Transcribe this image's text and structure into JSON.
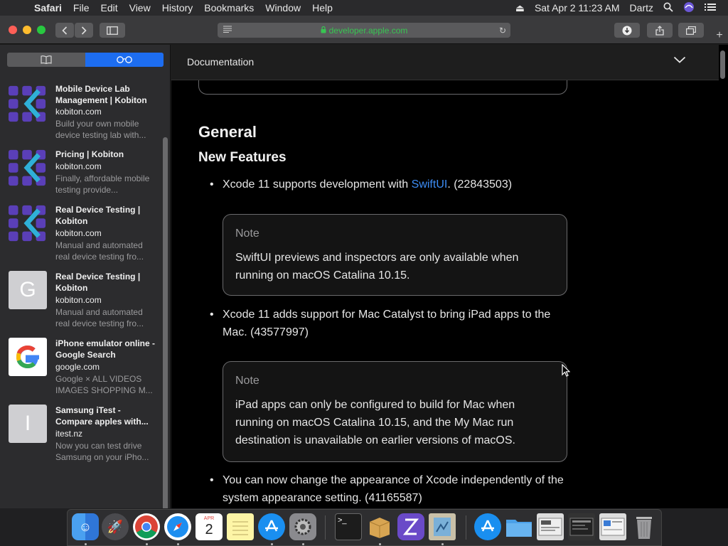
{
  "menubar": {
    "app": "Safari",
    "items": [
      "File",
      "Edit",
      "View",
      "History",
      "Bookmarks",
      "Window",
      "Help"
    ],
    "datetime": "Sat Apr 2  11:23 AM",
    "user": "Dartz"
  },
  "toolbar": {
    "url": "developer.apple.com"
  },
  "sidebar": {
    "items": [
      {
        "title": "Mobile Device Lab Management | Kobiton",
        "domain": "kobiton.com",
        "desc": "Build your own mobile device testing lab with...",
        "thumb": "kobiton-logo"
      },
      {
        "title": "Pricing | Kobiton",
        "domain": "kobiton.com",
        "desc": "Finally, affordable mobile testing provide...",
        "thumb": "kobiton-logo"
      },
      {
        "title": "Real Device Testing | Kobiton",
        "domain": "kobiton.com",
        "desc": "Manual and automated real device testing fro...",
        "thumb": "kobiton-logo"
      },
      {
        "title": "Real Device Testing | Kobiton",
        "domain": "kobiton.com",
        "desc": "Manual and automated real device testing fro...",
        "thumb": "G"
      },
      {
        "title": "iPhone emulator online - Google Search",
        "domain": "google.com",
        "desc": "Google × ALL VIDEOS IMAGES SHOPPING M...",
        "thumb": "google-logo"
      },
      {
        "title": "Samsung iTest - Compare apples with...",
        "domain": "itest.nz",
        "desc": "Now you can test drive Samsung on your iPho...",
        "thumb": "I"
      }
    ]
  },
  "doc": {
    "header": "Documentation",
    "section": "General",
    "subsection": "New Features",
    "bullet1_pre": "Xcode 11 supports development with ",
    "bullet1_link": "SwiftUI",
    "bullet1_post": ". (22843503)",
    "note1_label": "Note",
    "note1_body": "SwiftUI previews and inspectors are only available when running on macOS Catalina 10.15.",
    "bullet2": "Xcode 11 adds support for Mac Catalyst to bring iPad apps to the Mac. (43577997)",
    "note2_label": "Note",
    "note2_body": "iPad apps can only be configured to build for Mac when running on macOS Catalina 10.15, and the My Mac run destination is unavailable on earlier versions of macOS.",
    "bullet3": "You can now change the appearance of Xcode independently of the system appearance setting. (41165587)"
  },
  "dock": {
    "items": [
      "finder",
      "launchpad",
      "chrome",
      "safari",
      "calendar",
      "notes",
      "app-store",
      "system-preferences",
      "terminal",
      "archive-utility",
      "xcode-helper",
      "preview",
      "app-store-folder",
      "documents-folder",
      "screenshot-1",
      "screenshot-2",
      "screenshot-3",
      "trash"
    ],
    "calendar_month": "APR",
    "calendar_day": "2"
  },
  "colors": {
    "accent": "#1d6df0",
    "link": "#3d8df5",
    "secure": "#38c552"
  }
}
